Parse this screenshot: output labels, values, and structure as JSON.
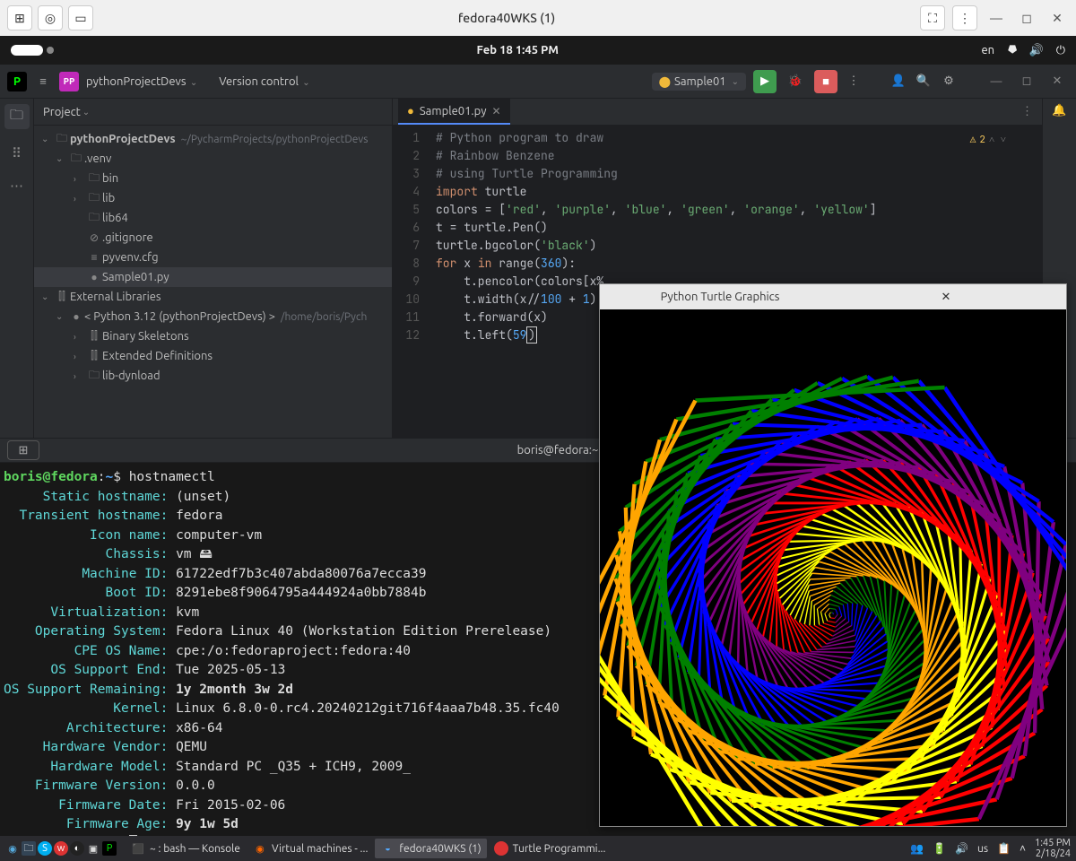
{
  "vm": {
    "title": "fedora40WKS (1)",
    "left_icons": [
      "grid-icon",
      "disc-icon",
      "display-icon"
    ],
    "right_icons": [
      "fullscreen-icon",
      "kebab-icon",
      "minimize-icon",
      "maximize-icon",
      "close-icon"
    ]
  },
  "gnome": {
    "datetime": "Feb 18   1:45 PM",
    "lang": "en",
    "tray": [
      "network-icon",
      "volume-icon",
      "power-icon"
    ]
  },
  "ide": {
    "project_name": "pythonProjectDevs",
    "version_control": "Version control",
    "run_config": "Sample01",
    "run_actions": [
      "run",
      "debug",
      "stop"
    ],
    "top_right_icons": [
      "more-icon",
      "user-icon",
      "search-icon",
      "settings-icon"
    ],
    "window_icons": [
      "minimize-icon",
      "maximize-icon",
      "close-icon"
    ],
    "panel_label": "Project",
    "tree": {
      "root": "pythonProjectDevs",
      "root_path": "~/PycharmProjects/pythonProjectDevs",
      "venv": ".venv",
      "bin": "bin",
      "lib": "lib",
      "lib64": "lib64",
      "gitignore": ".gitignore",
      "pyvenv": "pyvenv.cfg",
      "sample": "Sample01.py",
      "ext_lib": "External Libraries",
      "python_env": "< Python 3.12 (pythonProjectDevs) >",
      "python_env_path": "/home/boris/Pych",
      "bin_skel": "Binary Skeletons",
      "ext_def": "Extended Definitions",
      "lib_dyn": "lib-dynload"
    },
    "tab": "Sample01.py",
    "warnings": "2",
    "code_lines": 12,
    "code": {
      "l1": "# Python program to draw",
      "l2": "# Rainbow Benzene",
      "l3": "# using Turtle Programming",
      "l4_kw": "import",
      "l4_id": " turtle",
      "l5a": "colors = [",
      "l5b": "'red'",
      "l5c": "'purple'",
      "l5d": "'blue'",
      "l5e": "'green'",
      "l5f": "'orange'",
      "l5g": "'yellow'",
      "l6": "t = turtle.Pen()",
      "l7a": "turtle.bgcolor(",
      "l7b": "'black'",
      "l8a": "for",
      "l8b": " x ",
      "l8c": "in",
      "l8d": " range(",
      "l8e": "360",
      "l9a": "    t.pencolor(colors[x%",
      "l10a": "    t.width(x//",
      "l10b": "100",
      "l10c": " + ",
      "l10d": "1",
      "l11": "    t.forward(x)",
      "l12a": "    t.left(",
      "l12b": "59"
    }
  },
  "terminal": {
    "tab_title": "boris@fedora:~",
    "prompt_user": "boris@fedora",
    "prompt_sep": ":",
    "prompt_path": "~",
    "prompt_dollar": "$ ",
    "cmd": "hostnamectl",
    "rows": [
      {
        "k": "Static hostname",
        "v": "(unset)"
      },
      {
        "k": "Transient hostname",
        "v": "fedora"
      },
      {
        "k": "Icon name",
        "v": "computer-vm"
      },
      {
        "k": "Chassis",
        "v": "vm 🖴"
      },
      {
        "k": "Machine ID",
        "v": "61722edf7b3c407abda80076a7ecca39"
      },
      {
        "k": "Boot ID",
        "v": "8291ebe8f9064795a444924a0bb7884b"
      },
      {
        "k": "Virtualization",
        "v": "kvm"
      },
      {
        "k": "Operating System",
        "v": "Fedora Linux 40 (Workstation Edition Prerelease)"
      },
      {
        "k": "CPE OS Name",
        "v": "cpe:/o:fedoraproject:fedora:40"
      },
      {
        "k": "OS Support End",
        "v": "Tue 2025-05-13"
      },
      {
        "k": "OS Support Remaining",
        "v": "1y 2month 3w 2d",
        "bold": true
      },
      {
        "k": "Kernel",
        "v": "Linux 6.8.0-0.rc4.20240212git716f4aaa7b48.35.fc40"
      },
      {
        "k": "Architecture",
        "v": "x86-64"
      },
      {
        "k": "Hardware Vendor",
        "v": "QEMU"
      },
      {
        "k": "Hardware Model",
        "v": "Standard PC _Q35 + ICH9, 2009_"
      },
      {
        "k": "Firmware Version",
        "v": "0.0.0"
      },
      {
        "k": "Firmware Date",
        "v": "Fri 2015-02-06"
      },
      {
        "k": "Firmware Age",
        "v": "9y 1w 5d",
        "bold": true
      }
    ]
  },
  "turtle": {
    "title": "Python Turtle Graphics"
  },
  "host": {
    "tasks": [
      {
        "label": "~ : bash — Konsole"
      },
      {
        "label": "Virtual machines - ..."
      },
      {
        "label": "fedora40WKS (1)",
        "active": true
      },
      {
        "label": "Turtle Programmi..."
      }
    ],
    "kb": "us",
    "time": "1:45 PM",
    "date": "2/18/24"
  }
}
